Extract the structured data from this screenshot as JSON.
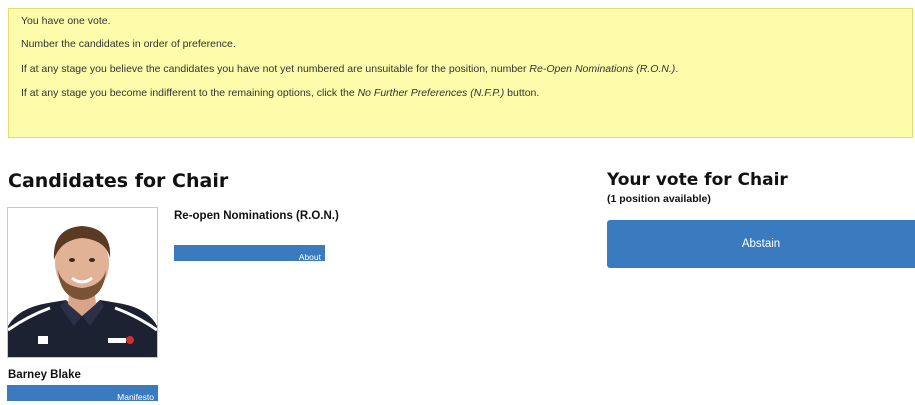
{
  "notice": {
    "line1": "You have one vote.",
    "line2": "Number the candidates in order of preference.",
    "line3_prefix": "If at any stage you believe the candidates you have not yet numbered are unsuitable for the position, number ",
    "line3_em": "Re-Open Nominations (R.O.N.)",
    "line3_suffix": ".",
    "line4_prefix": "If at any stage you become indifferent to the remaining options, click the ",
    "line4_em": "No Further Preferences (N.F.P.)",
    "line4_suffix": " button."
  },
  "candidates": {
    "heading": "Candidates for Chair",
    "items": [
      {
        "name": "Barney Blake",
        "link_label": "Manifesto"
      },
      {
        "name": "Re-open Nominations (R.O.N.)",
        "link_label": "About"
      }
    ]
  },
  "vote": {
    "heading": "Your vote for Chair",
    "subheading": "(1 position available)",
    "abstain_label": "Abstain"
  },
  "colors": {
    "notice_bg": "#fdfcaa",
    "accent_blue": "#3a7bbf"
  }
}
